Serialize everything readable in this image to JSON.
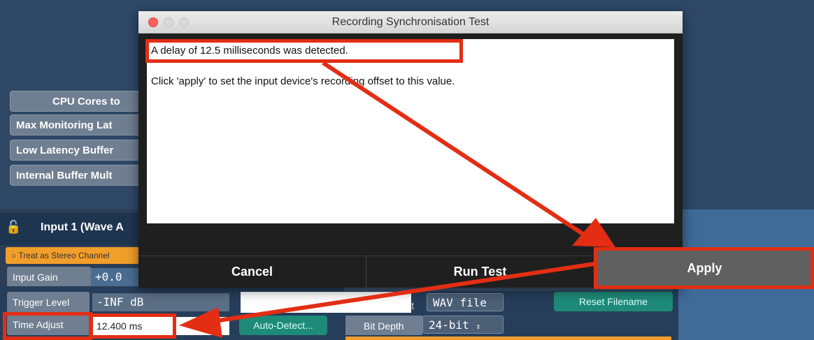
{
  "background": {
    "settings_buttons": [
      "CPU Cores to",
      "Max Monitoring Lat",
      "Low Latency Buffer",
      "Internal Buffer Mult"
    ],
    "input_header": "Input 1 (Wave A",
    "stereo_button": "Treat as Stereo Channel",
    "input_gain_label": "Input Gain",
    "input_gain_value": "+0.0",
    "trigger_level_label": "Trigger Level",
    "trigger_level_value": "-INF dB",
    "time_adjust_label": "Time Adjust",
    "time_adjust_value": "12.400 ms",
    "auto_detect_button": "Auto-Detect...",
    "file_format_label": "t",
    "file_format_value": "WAV file",
    "reset_filename_button": "Reset Filename",
    "bit_depth_label": "Bit Depth",
    "bit_depth_value": "24-bit"
  },
  "dialog": {
    "title": "Recording Synchronisation Test",
    "message_line1": "A delay of 12.5 milliseconds was detected.",
    "message_line2": "Click 'apply' to set the input device's recording offset to this value.",
    "cancel_label": "Cancel",
    "run_test_label": "Run Test",
    "apply_label": "Apply"
  },
  "colors": {
    "annotation_red": "#e32e14",
    "stereo_orange": "#f29e2a",
    "teal_button": "#1e8a78"
  }
}
